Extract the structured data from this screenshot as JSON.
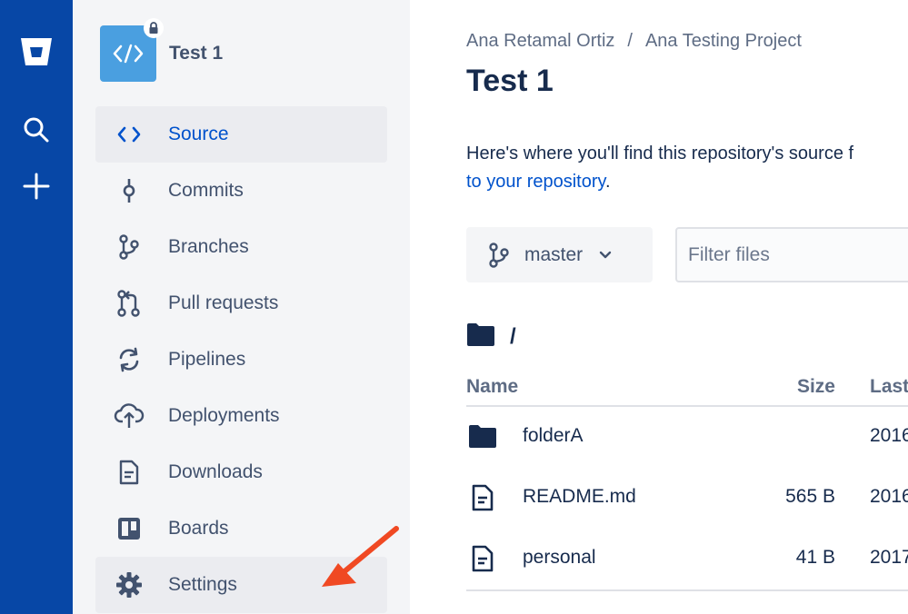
{
  "sidebar": {
    "repo_name": "Test 1",
    "items": [
      {
        "label": "Source",
        "icon": "code-icon"
      },
      {
        "label": "Commits",
        "icon": "commit-icon"
      },
      {
        "label": "Branches",
        "icon": "branch-icon"
      },
      {
        "label": "Pull requests",
        "icon": "pull-request-icon"
      },
      {
        "label": "Pipelines",
        "icon": "pipelines-icon"
      },
      {
        "label": "Deployments",
        "icon": "cloud-upload-icon"
      },
      {
        "label": "Downloads",
        "icon": "document-icon"
      },
      {
        "label": "Boards",
        "icon": "board-icon"
      },
      {
        "label": "Settings",
        "icon": "gear-icon"
      }
    ]
  },
  "breadcrumb": {
    "owner": "Ana Retamal Ortiz",
    "separator": "/",
    "project": "Ana Testing Project"
  },
  "main": {
    "title": "Test 1",
    "description_text": "Here's where you'll find this repository's source f",
    "description_link": "to your repository",
    "description_end": ".",
    "branch": "master",
    "filter_placeholder": "Filter files",
    "path": "/"
  },
  "table": {
    "headers": {
      "name": "Name",
      "size": "Size",
      "last": "Last"
    },
    "rows": [
      {
        "name": "folderA",
        "size": "",
        "last": "2016",
        "type": "folder"
      },
      {
        "name": "README.md",
        "size": "565 B",
        "last": "2016",
        "type": "file"
      },
      {
        "name": "personal",
        "size": "41 B",
        "last": "2017",
        "type": "file"
      }
    ]
  },
  "colors": {
    "global_nav": "#0747a6",
    "accent": "#0052cc",
    "arrow": "#f04923"
  }
}
